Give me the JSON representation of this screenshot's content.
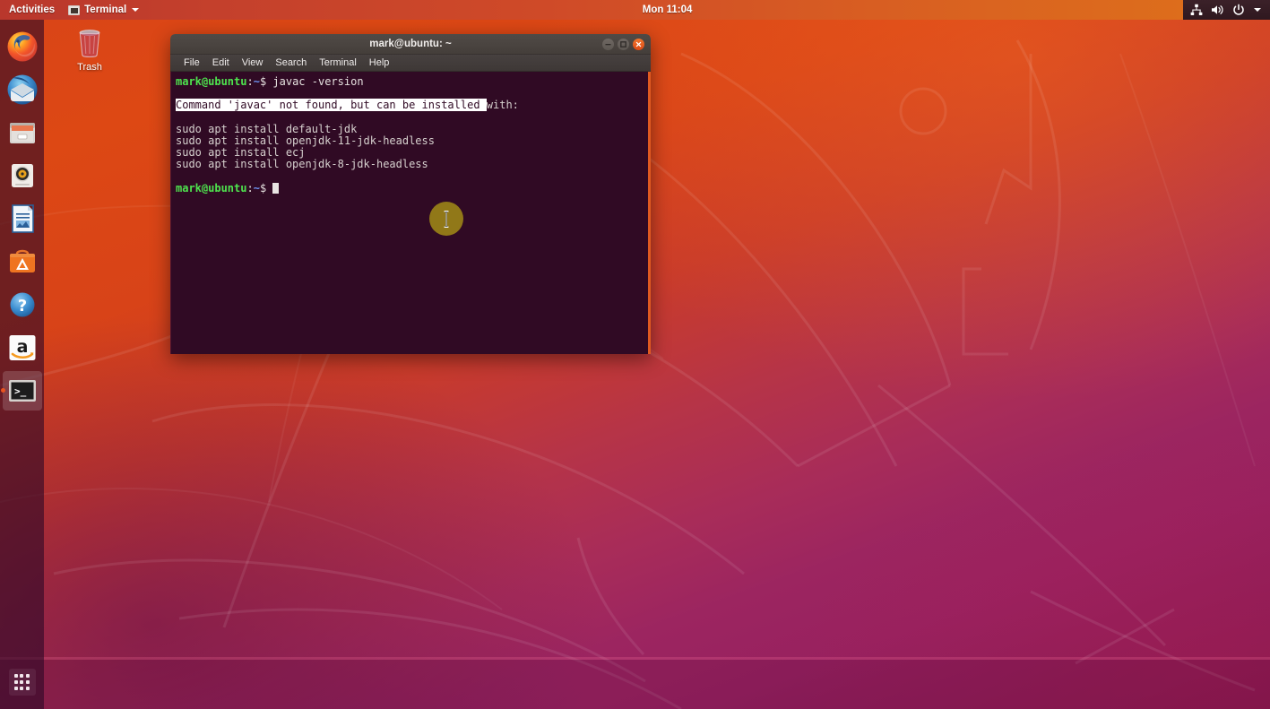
{
  "topbar": {
    "activities": "Activities",
    "app_icon": "terminal-icon",
    "app_name": "Terminal",
    "caret": "chevron-down-icon",
    "clock": "Mon 11:04",
    "indicators": [
      {
        "name": "network-icon"
      },
      {
        "name": "volume-icon"
      },
      {
        "name": "power-icon"
      },
      {
        "name": "chevron-down-icon"
      }
    ]
  },
  "dock": {
    "items": [
      {
        "name": "firefox",
        "label": "Firefox Web Browser",
        "active": false
      },
      {
        "name": "thunderbird",
        "label": "Thunderbird Mail",
        "active": false
      },
      {
        "name": "files",
        "label": "Files",
        "active": false
      },
      {
        "name": "rhythmbox",
        "label": "Rhythmbox",
        "active": false
      },
      {
        "name": "libreoffice-writer",
        "label": "LibreOffice Writer",
        "active": false
      },
      {
        "name": "ubuntu-software",
        "label": "Ubuntu Software",
        "active": false
      },
      {
        "name": "help",
        "label": "Help",
        "active": false
      },
      {
        "name": "amazon",
        "label": "Amazon",
        "active": false
      },
      {
        "name": "terminal",
        "label": "Terminal",
        "active": true
      }
    ],
    "show_apps": "Show Applications"
  },
  "desktop": {
    "trash_label": "Trash"
  },
  "terminal": {
    "title": "mark@ubuntu: ~",
    "window_buttons": {
      "minimize": "minimize-icon",
      "maximize": "maximize-icon",
      "close": "close-icon"
    },
    "menu": [
      "File",
      "Edit",
      "View",
      "Search",
      "Terminal",
      "Help"
    ],
    "prompt": {
      "user_host": "mark@ubuntu",
      "colon": ":",
      "path": "~",
      "dollar": "$ "
    },
    "command": "javac -version",
    "output_selected": "Command 'javac' not found, but can be installed ",
    "output_tail": "with:",
    "suggestions": [
      "sudo apt install default-jdk",
      "sudo apt install openjdk-11-jdk-headless",
      "sudo apt install ecj",
      "sudo apt install openjdk-8-jdk-headless"
    ]
  },
  "colors": {
    "ubuntu_orange": "#e95420",
    "terminal_bg": "#300a24",
    "prompt_green": "#4ee44e",
    "prompt_blue": "#6d91f0",
    "topbar_start": "#b9372c",
    "topbar_end": "#dd6d1c"
  }
}
